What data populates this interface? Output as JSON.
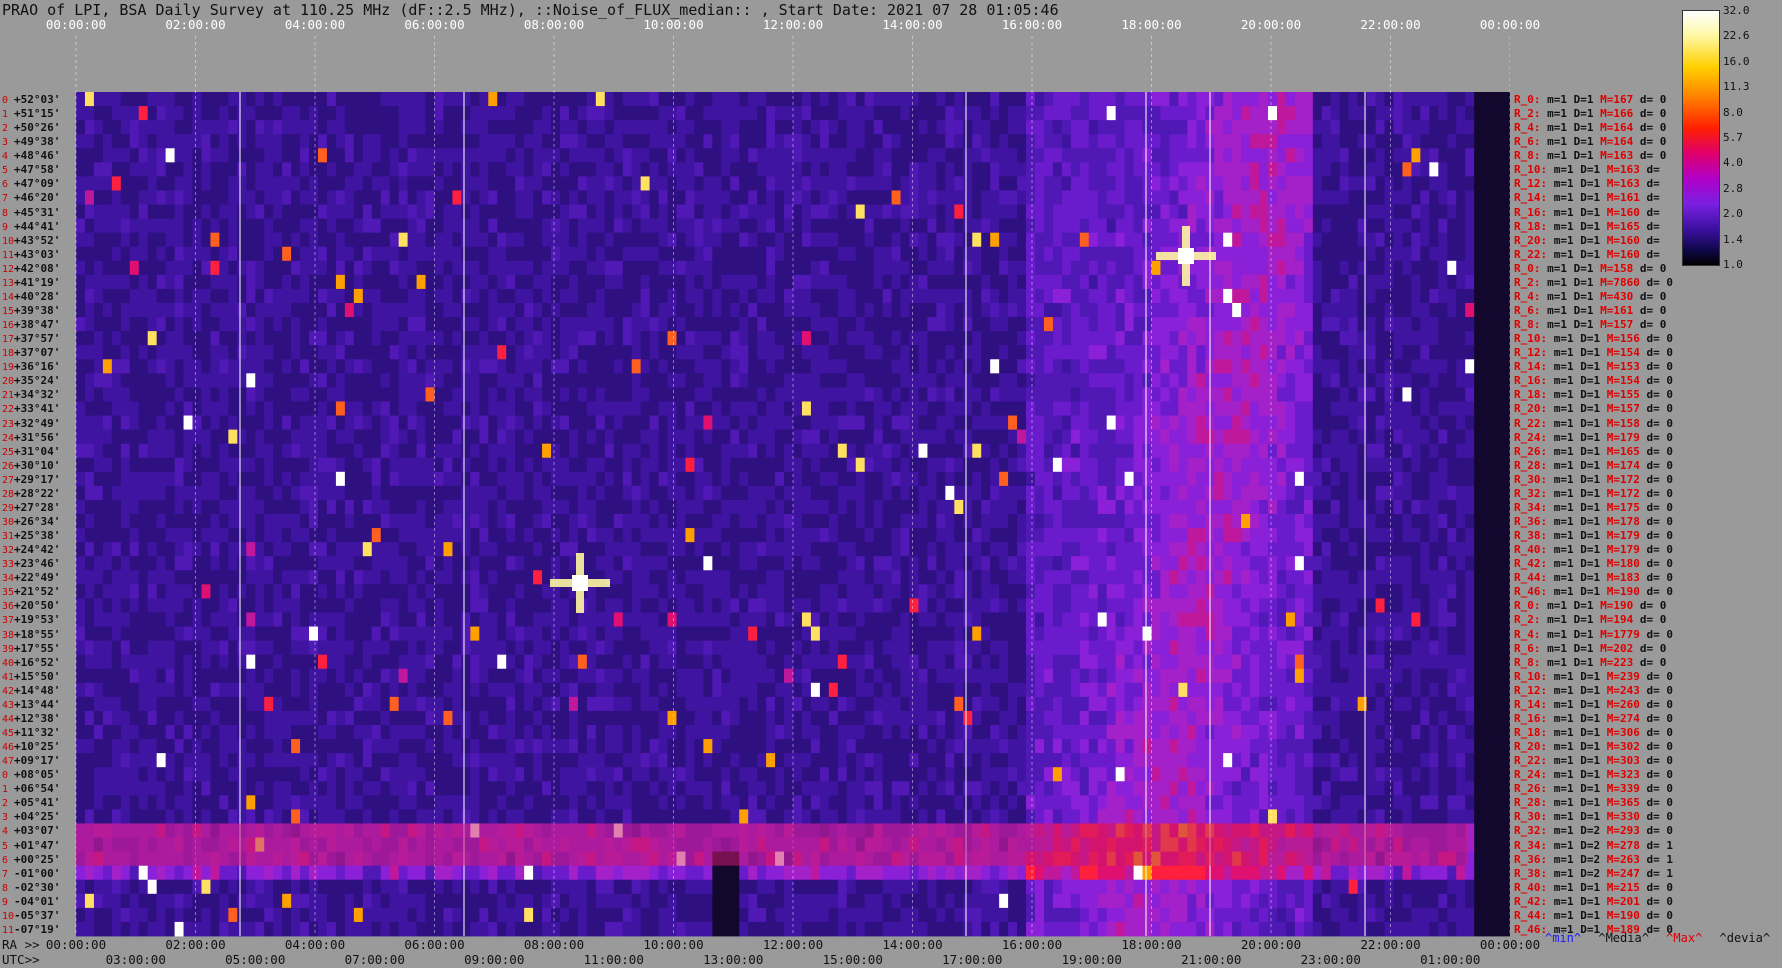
{
  "title": "PRAO of LPI, BSA Daily Survey at 110.25 MHz (dF::2.5 MHz), ::Noise_of_FLUX_median:: , Start Date: 2021 07 28 01:05:46",
  "chart_data": {
    "type": "heatmap",
    "title": "PRAO of LPI, BSA Daily Survey at 110.25 MHz (dF::2.5 MHz), ::Noise_of_FLUX_median:: , Start Date: 2021 07 28 01:05:46",
    "top_axis_labels": [
      "00:00:00",
      "02:00:00",
      "04:00:00",
      "06:00:00",
      "08:00:00",
      "10:00:00",
      "12:00:00",
      "14:00:00",
      "16:00:00",
      "18:00:00",
      "20:00:00",
      "22:00:00",
      "00:00:00"
    ],
    "ra_axis_title": "RA >>",
    "ra_axis_labels": [
      "00:00:00",
      "02:00:00",
      "04:00:00",
      "06:00:00",
      "08:00:00",
      "10:00:00",
      "12:00:00",
      "14:00:00",
      "16:00:00",
      "18:00:00",
      "20:00:00",
      "22:00:00",
      "00:00:00"
    ],
    "utc_axis_title": "UTC>>",
    "utc_axis_labels": [
      "03:00:00",
      "05:00:00",
      "07:00:00",
      "09:00:00",
      "11:00:00",
      "13:00:00",
      "15:00:00",
      "17:00:00",
      "19:00:00",
      "21:00:00",
      "23:00:00",
      "01:00:00"
    ],
    "dec_labels": [
      "+52°03'",
      "+51°15'",
      "+50°26'",
      "+49°38'",
      "+48°46'",
      "+47°58'",
      "+47°09'",
      "+46°20'",
      "+45°31'",
      "+44°41'",
      "+43°52'",
      "+43°03'",
      "+42°08'",
      "+41°19'",
      "+40°28'",
      "+39°38'",
      "+38°47'",
      "+37°57'",
      "+37°07'",
      "+36°16'",
      "+35°24'",
      "+34°32'",
      "+33°41'",
      "+32°49'",
      "+31°56'",
      "+31°04'",
      "+30°10'",
      "+29°17'",
      "+28°22'",
      "+27°28'",
      "+26°34'",
      "+25°38'",
      "+24°42'",
      "+23°46'",
      "+22°49'",
      "+21°52'",
      "+20°50'",
      "+19°53'",
      "+18°55'",
      "+17°55'",
      "+16°52'",
      "+15°50'",
      "+14°48'",
      "+13°44'",
      "+12°38'",
      "+11°32'",
      "+10°25'",
      "+09°17'",
      "+08°05'",
      "+06°54'",
      "+05°41'",
      "+04°25'",
      "+03°07'",
      "+01°47'",
      "+00°25'",
      "-01°00'",
      "-02°30'",
      "-04°01'",
      "-05°37'",
      "-07°19'"
    ],
    "row_numbers": [
      "0",
      "1",
      "2",
      "3",
      "4",
      "5",
      "6",
      "7",
      "8",
      "9",
      "10",
      "11",
      "12",
      "13",
      "14",
      "15",
      "16",
      "17",
      "18",
      "19",
      "20",
      "21",
      "22",
      "23",
      "24",
      "25",
      "26",
      "27",
      "28",
      "29",
      "30",
      "31",
      "32",
      "33",
      "34",
      "35",
      "36",
      "37",
      "38",
      "39",
      "40",
      "41",
      "42",
      "43",
      "44",
      "45",
      "46",
      "47",
      "0",
      "1",
      "2",
      "3",
      "4",
      "5",
      "6",
      "7",
      "8",
      "9",
      "10",
      "11",
      "12",
      "13",
      "14",
      "15",
      "16",
      "17",
      "18",
      "19",
      "20",
      "21",
      "22",
      "23",
      "24",
      "25",
      "26",
      "27",
      "28",
      "29",
      "30",
      "31",
      "32",
      "33",
      "34",
      "35",
      "36",
      "37",
      "38",
      "39",
      "40",
      "41",
      "42",
      "43",
      "44",
      "45",
      "46",
      "47"
    ],
    "row_stats": [
      {
        "r": "R_0:",
        "m": "1",
        "D": "1",
        "M": "167",
        "d": "0"
      },
      {
        "r": "R_2:",
        "m": "1",
        "D": "1",
        "M": "166",
        "d": "0"
      },
      {
        "r": "R_4:",
        "m": "1",
        "D": "1",
        "M": "164",
        "d": "0"
      },
      {
        "r": "R_6:",
        "m": "1",
        "D": "1",
        "M": "164",
        "d": "0"
      },
      {
        "r": "R_8:",
        "m": "1",
        "D": "1",
        "M": "163",
        "d": "0"
      },
      {
        "r": "R_10:",
        "m": "1",
        "D": "1",
        "M": "163",
        "d": ""
      },
      {
        "r": "R_12:",
        "m": "1",
        "D": "1",
        "M": "163",
        "d": ""
      },
      {
        "r": "R_14:",
        "m": "1",
        "D": "1",
        "M": "161",
        "d": ""
      },
      {
        "r": "R_16:",
        "m": "1",
        "D": "1",
        "M": "160",
        "d": ""
      },
      {
        "r": "R_18:",
        "m": "1",
        "D": "1",
        "M": "165",
        "d": ""
      },
      {
        "r": "R_20:",
        "m": "1",
        "D": "1",
        "M": "160",
        "d": ""
      },
      {
        "r": "R_22:",
        "m": "1",
        "D": "1",
        "M": "160",
        "d": ""
      },
      {
        "r": "R_0:",
        "m": "1",
        "D": "1",
        "M": "158",
        "d": "0"
      },
      {
        "r": "R_2:",
        "m": "1",
        "D": "1",
        "M": "7860",
        "d": "0"
      },
      {
        "r": "R_4:",
        "m": "1",
        "D": "1",
        "M": "430",
        "d": "0"
      },
      {
        "r": "R_6:",
        "m": "1",
        "D": "1",
        "M": "161",
        "d": "0"
      },
      {
        "r": "R_8:",
        "m": "1",
        "D": "1",
        "M": "157",
        "d": "0"
      },
      {
        "r": "R_10:",
        "m": "1",
        "D": "1",
        "M": "156",
        "d": "0"
      },
      {
        "r": "R_12:",
        "m": "1",
        "D": "1",
        "M": "154",
        "d": "0"
      },
      {
        "r": "R_14:",
        "m": "1",
        "D": "1",
        "M": "153",
        "d": "0"
      },
      {
        "r": "R_16:",
        "m": "1",
        "D": "1",
        "M": "154",
        "d": "0"
      },
      {
        "r": "R_18:",
        "m": "1",
        "D": "1",
        "M": "155",
        "d": "0"
      },
      {
        "r": "R_20:",
        "m": "1",
        "D": "1",
        "M": "157",
        "d": "0"
      },
      {
        "r": "R_22:",
        "m": "1",
        "D": "1",
        "M": "158",
        "d": "0"
      },
      {
        "r": "R_24:",
        "m": "1",
        "D": "1",
        "M": "179",
        "d": "0"
      },
      {
        "r": "R_26:",
        "m": "1",
        "D": "1",
        "M": "165",
        "d": "0"
      },
      {
        "r": "R_28:",
        "m": "1",
        "D": "1",
        "M": "174",
        "d": "0"
      },
      {
        "r": "R_30:",
        "m": "1",
        "D": "1",
        "M": "172",
        "d": "0"
      },
      {
        "r": "R_32:",
        "m": "1",
        "D": "1",
        "M": "172",
        "d": "0"
      },
      {
        "r": "R_34:",
        "m": "1",
        "D": "1",
        "M": "175",
        "d": "0"
      },
      {
        "r": "R_36:",
        "m": "1",
        "D": "1",
        "M": "178",
        "d": "0"
      },
      {
        "r": "R_38:",
        "m": "1",
        "D": "1",
        "M": "179",
        "d": "0"
      },
      {
        "r": "R_40:",
        "m": "1",
        "D": "1",
        "M": "179",
        "d": "0"
      },
      {
        "r": "R_42:",
        "m": "1",
        "D": "1",
        "M": "180",
        "d": "0"
      },
      {
        "r": "R_44:",
        "m": "1",
        "D": "1",
        "M": "183",
        "d": "0"
      },
      {
        "r": "R_46:",
        "m": "1",
        "D": "1",
        "M": "190",
        "d": "0"
      },
      {
        "r": "R_0:",
        "m": "1",
        "D": "1",
        "M": "190",
        "d": "0"
      },
      {
        "r": "R_2:",
        "m": "1",
        "D": "1",
        "M": "194",
        "d": "0"
      },
      {
        "r": "R_4:",
        "m": "1",
        "D": "1",
        "M": "1779",
        "d": "0"
      },
      {
        "r": "R_6:",
        "m": "1",
        "D": "1",
        "M": "202",
        "d": "0"
      },
      {
        "r": "R_8:",
        "m": "1",
        "D": "1",
        "M": "223",
        "d": "0"
      },
      {
        "r": "R_10:",
        "m": "1",
        "D": "1",
        "M": "239",
        "d": "0"
      },
      {
        "r": "R_12:",
        "m": "1",
        "D": "1",
        "M": "243",
        "d": "0"
      },
      {
        "r": "R_14:",
        "m": "1",
        "D": "1",
        "M": "260",
        "d": "0"
      },
      {
        "r": "R_16:",
        "m": "1",
        "D": "1",
        "M": "274",
        "d": "0"
      },
      {
        "r": "R_18:",
        "m": "1",
        "D": "1",
        "M": "306",
        "d": "0"
      },
      {
        "r": "R_20:",
        "m": "1",
        "D": "1",
        "M": "302",
        "d": "0"
      },
      {
        "r": "R_22:",
        "m": "1",
        "D": "1",
        "M": "303",
        "d": "0"
      },
      {
        "r": "R_24:",
        "m": "1",
        "D": "1",
        "M": "323",
        "d": "0"
      },
      {
        "r": "R_26:",
        "m": "1",
        "D": "1",
        "M": "339",
        "d": "0"
      },
      {
        "r": "R_28:",
        "m": "1",
        "D": "1",
        "M": "365",
        "d": "0"
      },
      {
        "r": "R_30:",
        "m": "1",
        "D": "1",
        "M": "330",
        "d": "0"
      },
      {
        "r": "R_32:",
        "m": "1",
        "D": "2",
        "M": "293",
        "d": "0"
      },
      {
        "r": "R_34:",
        "m": "1",
        "D": "2",
        "M": "278",
        "d": "1"
      },
      {
        "r": "R_36:",
        "m": "1",
        "D": "2",
        "M": "263",
        "d": "1"
      },
      {
        "r": "R_38:",
        "m": "1",
        "D": "2",
        "M": "247",
        "d": "1"
      },
      {
        "r": "R_40:",
        "m": "1",
        "D": "1",
        "M": "215",
        "d": "0"
      },
      {
        "r": "R_42:",
        "m": "1",
        "D": "1",
        "M": "201",
        "d": "0"
      },
      {
        "r": "R_44:",
        "m": "1",
        "D": "1",
        "M": "190",
        "d": "0"
      },
      {
        "r": "R_46:",
        "m": "1",
        "D": "1",
        "M": "189",
        "d": "0"
      }
    ],
    "colorbar": {
      "ticks": [
        "32.0",
        "22.6",
        "16.0",
        "11.3",
        "8.0",
        "5.7",
        "4.0",
        "2.8",
        "2.0",
        "1.4",
        "1.0"
      ],
      "range": [
        1.0,
        32.0
      ],
      "scale": "log"
    },
    "legend": [
      "^min^",
      "^Media^",
      "^Max^",
      "^devia^"
    ],
    "colors": {
      "background": "#9a9a9a",
      "map_low": "#000000",
      "map_mid": "#5a1ab8",
      "map_high": "#ff2000",
      "map_peak": "#ffffff"
    }
  }
}
